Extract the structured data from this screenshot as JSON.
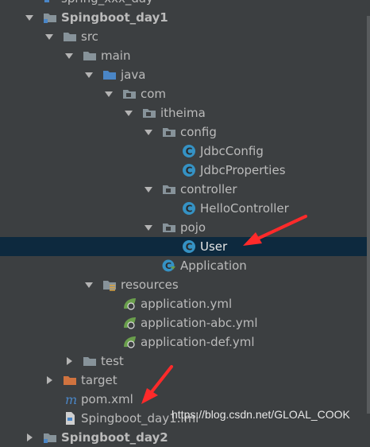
{
  "tree": [
    {
      "label": "spring_xxx_day",
      "indent": 0,
      "arrow": "none",
      "icon": "module-icon",
      "style": "normal",
      "name": "tree-row-partial-top"
    },
    {
      "label": "Spingboot_day1",
      "indent": 0,
      "arrow": "open",
      "icon": "module-folder-icon",
      "style": "bold",
      "name": "tree-row-spingboot-day1"
    },
    {
      "label": "src",
      "indent": 1,
      "arrow": "open",
      "icon": "folder-icon",
      "style": "normal",
      "name": "tree-row-src"
    },
    {
      "label": "main",
      "indent": 2,
      "arrow": "open",
      "icon": "folder-icon",
      "style": "normal",
      "name": "tree-row-main"
    },
    {
      "label": "java",
      "indent": 3,
      "arrow": "open",
      "icon": "source-folder-icon",
      "style": "normal",
      "name": "tree-row-java"
    },
    {
      "label": "com",
      "indent": 4,
      "arrow": "open",
      "icon": "package-icon",
      "style": "normal",
      "name": "tree-row-com"
    },
    {
      "label": "itheima",
      "indent": 5,
      "arrow": "open",
      "icon": "package-icon",
      "style": "normal",
      "name": "tree-row-itheima"
    },
    {
      "label": "config",
      "indent": 6,
      "arrow": "open",
      "icon": "package-icon",
      "style": "normal",
      "name": "tree-row-config"
    },
    {
      "label": "JdbcConfig",
      "indent": 7,
      "arrow": "none",
      "icon": "class-icon",
      "style": "normal",
      "name": "tree-row-jdbcconfig"
    },
    {
      "label": "JdbcProperties",
      "indent": 7,
      "arrow": "none",
      "icon": "class-icon",
      "style": "normal",
      "name": "tree-row-jdbcproperties"
    },
    {
      "label": "controller",
      "indent": 6,
      "arrow": "open",
      "icon": "package-icon",
      "style": "normal",
      "name": "tree-row-controller"
    },
    {
      "label": "HelloController",
      "indent": 7,
      "arrow": "none",
      "icon": "class-icon",
      "style": "normal",
      "name": "tree-row-hellocontroller"
    },
    {
      "label": "pojo",
      "indent": 6,
      "arrow": "open",
      "icon": "package-icon",
      "style": "normal",
      "name": "tree-row-pojo"
    },
    {
      "label": "User",
      "indent": 7,
      "arrow": "none",
      "icon": "class-icon",
      "style": "selected",
      "name": "tree-row-user"
    },
    {
      "label": "Application",
      "indent": 6,
      "arrow": "none",
      "icon": "spring-app-icon",
      "style": "normal",
      "name": "tree-row-application"
    },
    {
      "label": "resources",
      "indent": 3,
      "arrow": "open",
      "icon": "resources-folder-icon",
      "style": "normal",
      "name": "tree-row-resources"
    },
    {
      "label": "application.yml",
      "indent": 4,
      "arrow": "none",
      "icon": "spring-config-icon",
      "style": "normal",
      "name": "tree-row-application-yml"
    },
    {
      "label": "application-abc.yml",
      "indent": 4,
      "arrow": "none",
      "icon": "spring-config-icon",
      "style": "normal",
      "name": "tree-row-application-abc-yml"
    },
    {
      "label": "application-def.yml",
      "indent": 4,
      "arrow": "none",
      "icon": "spring-config-icon",
      "style": "normal",
      "name": "tree-row-application-def-yml"
    },
    {
      "label": "test",
      "indent": 2,
      "arrow": "closed",
      "icon": "folder-icon",
      "style": "normal",
      "name": "tree-row-test"
    },
    {
      "label": "target",
      "indent": 1,
      "arrow": "closed",
      "icon": "excluded-folder-icon",
      "style": "orange",
      "name": "tree-row-target"
    },
    {
      "label": "pom.xml",
      "indent": 1,
      "arrow": "none",
      "icon": "maven-icon",
      "style": "normal",
      "name": "tree-row-pom-xml"
    },
    {
      "label": "Spingboot_day1.iml",
      "indent": 1,
      "arrow": "none",
      "icon": "iml-file-icon",
      "style": "normal",
      "name": "tree-row-iml"
    },
    {
      "label": "Spingboot_day2",
      "indent": 0,
      "arrow": "closed",
      "icon": "module-folder-icon",
      "style": "bold",
      "name": "tree-row-partial-bottom"
    }
  ],
  "watermark": "https://blog.csdn.net/GLOAL_COOK",
  "colors": {
    "background": "#3c3f41",
    "selected_row": "#0d293e",
    "folder": "#87939a",
    "source_folder": "#4a86c7",
    "class_icon": "#3592c4",
    "spring": "#6a9f4c",
    "excluded_folder": "#d0733f",
    "annotation_arrow": "#ff2a2a"
  }
}
